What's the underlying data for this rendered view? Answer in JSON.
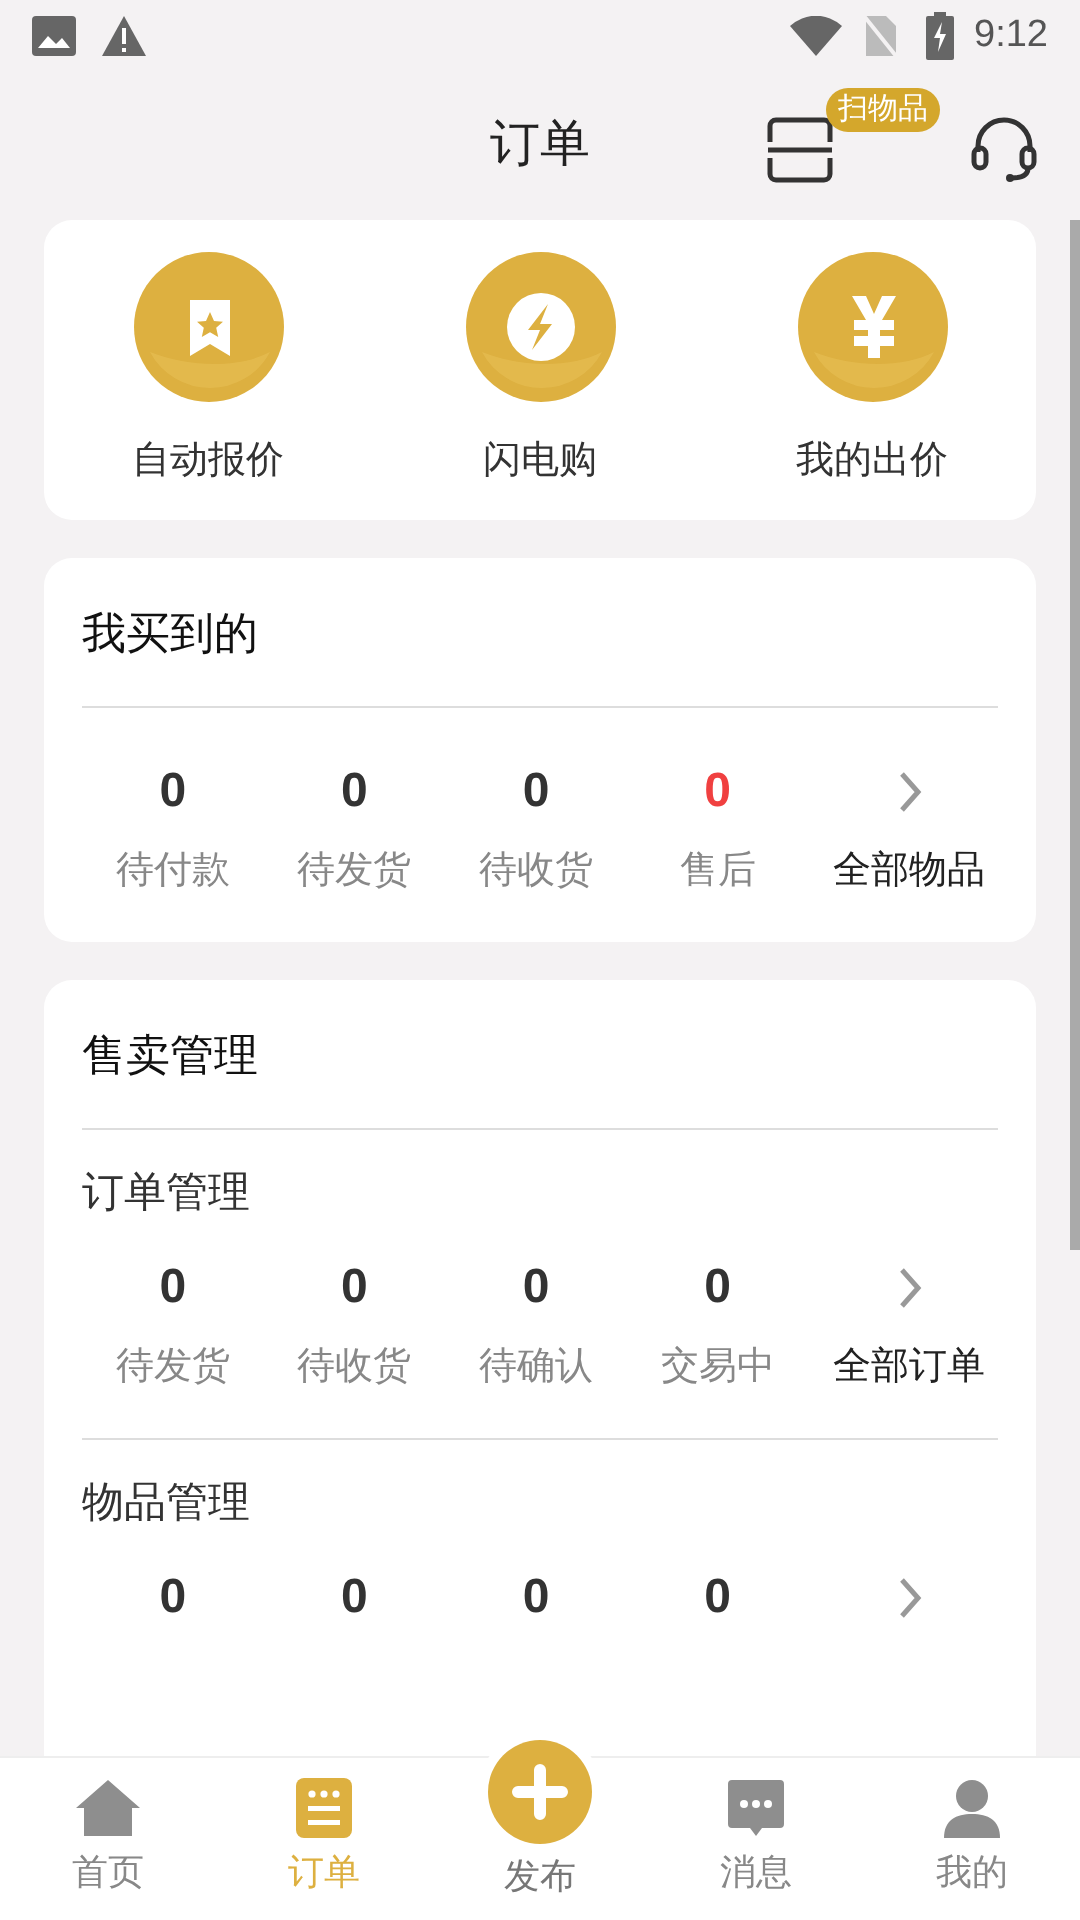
{
  "status_bar": {
    "time": "9:12"
  },
  "header": {
    "title": "订单",
    "scan_badge": "扫物品"
  },
  "shortcuts": [
    {
      "kind": "bookmark",
      "label": "自动报价"
    },
    {
      "kind": "flash",
      "label": "闪电购"
    },
    {
      "kind": "yen",
      "label": "我的出价"
    }
  ],
  "bought": {
    "title": "我买到的",
    "all_link": "全部物品",
    "stats": [
      {
        "count": "0",
        "label": "待付款",
        "alert": false
      },
      {
        "count": "0",
        "label": "待发货",
        "alert": false
      },
      {
        "count": "0",
        "label": "待收货",
        "alert": false
      },
      {
        "count": "0",
        "label": "售后",
        "alert": true
      }
    ]
  },
  "selling": {
    "title": "售卖管理",
    "groups": [
      {
        "title": "订单管理",
        "all_link": "全部订单",
        "stats": [
          {
            "count": "0",
            "label": "待发货",
            "alert": false
          },
          {
            "count": "0",
            "label": "待收货",
            "alert": false
          },
          {
            "count": "0",
            "label": "待确认",
            "alert": false
          },
          {
            "count": "0",
            "label": "交易中",
            "alert": false
          }
        ]
      },
      {
        "title": "物品管理",
        "stats": [
          {
            "count": "0",
            "alert": false
          },
          {
            "count": "0",
            "alert": false
          },
          {
            "count": "0",
            "alert": false
          },
          {
            "count": "0",
            "alert": false
          }
        ]
      }
    ]
  },
  "tabs": [
    {
      "kind": "home",
      "label": "首页",
      "selected": false
    },
    {
      "kind": "orders",
      "label": "订单",
      "selected": true
    },
    {
      "kind": "publish",
      "label": "发布",
      "selected": false
    },
    {
      "kind": "messages",
      "label": "消息",
      "selected": false
    },
    {
      "kind": "profile",
      "label": "我的",
      "selected": false
    }
  ]
}
